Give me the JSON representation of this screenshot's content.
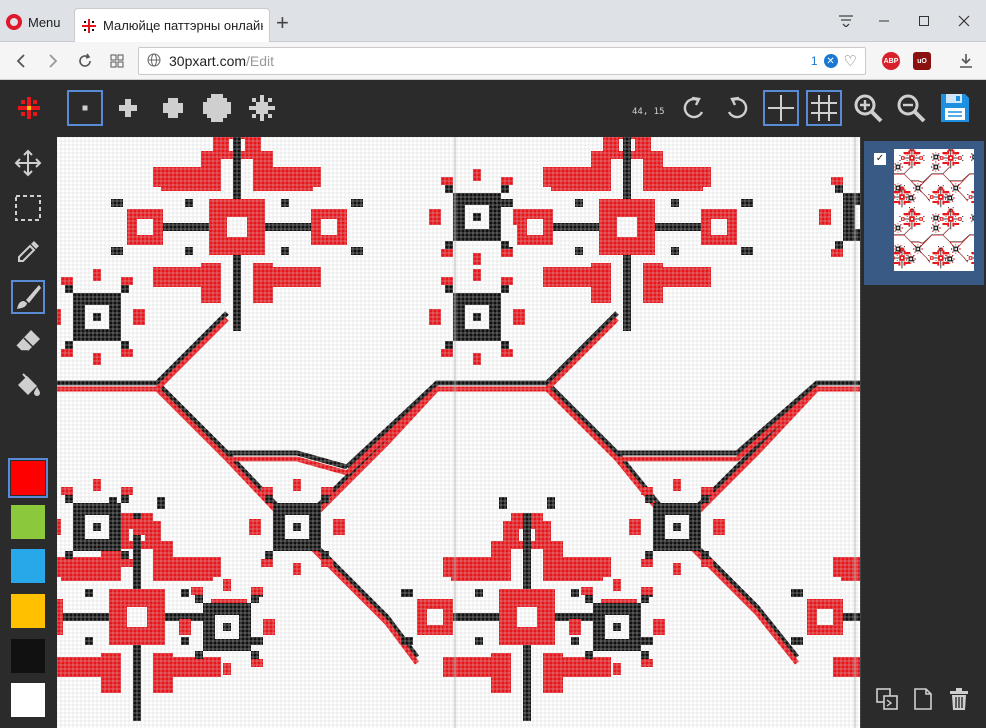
{
  "browser": {
    "menu_label": "Menu",
    "tab_title": "Малюйце паттэрны онлайн",
    "tab_close": "×",
    "new_tab": "+",
    "url_host": "30pxart.com",
    "url_path": "/Edit",
    "badge_count": "1",
    "extensions": [
      "ABP",
      "uO"
    ],
    "window_controls": [
      "minimize",
      "maximize",
      "close"
    ]
  },
  "toolbar": {
    "brush_sizes": [
      "brush-size-1",
      "brush-size-plus",
      "brush-size-medium",
      "brush-size-large",
      "brush-symmetry"
    ],
    "coordinates": "44, 15",
    "actions": [
      "undo",
      "redo",
      "grid-toggle",
      "grid-fine",
      "zoom-in",
      "zoom-out",
      "save"
    ]
  },
  "tools": [
    "move",
    "select",
    "eyedropper",
    "brush",
    "eraser",
    "fill"
  ],
  "palette": {
    "colors": [
      "#ff0000",
      "#8cc83c",
      "#28a8e8",
      "#ffc000",
      "#111111",
      "#ffffff"
    ],
    "selected": 0
  },
  "pattern": {
    "red": "#e8161b",
    "black": "#111111",
    "background": "#ffffff"
  },
  "layers": {
    "items": [
      {
        "visible": true,
        "selected": true
      }
    ]
  },
  "right_actions": [
    "duplicate-layer",
    "new-layer",
    "delete-layer"
  ]
}
